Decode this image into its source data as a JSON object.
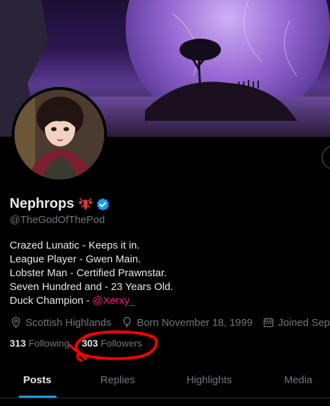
{
  "profile": {
    "name": "Nephrops",
    "name_emoji": "🦞",
    "handle": "@TheGodOfThePod",
    "verified": true
  },
  "bio": {
    "line1": "Crazed Lunatic - Keeps it in.",
    "line2": "League Player - Gwen Main.",
    "line3": "Lobster Man - Certified Prawnstar.",
    "line4": "Seven Hundred and - 23 Years Old.",
    "line5_prefix": "Duck Champion - ",
    "line5_mention": "@Xerxy_"
  },
  "meta": {
    "location": "Scottish Highlands",
    "born": "Born November 18, 1999",
    "joined": "Joined Sep"
  },
  "stats": {
    "following_count": "313",
    "following_label": "Following",
    "followers_count": "303",
    "followers_label": "Followers"
  },
  "tabs": [
    {
      "label": "Posts",
      "active": true
    },
    {
      "label": "Replies",
      "active": false
    },
    {
      "label": "Highlights",
      "active": false
    },
    {
      "label": "Media",
      "active": false
    }
  ],
  "colors": {
    "background": "#000000",
    "text": "#e7e9ea",
    "muted": "#71767b",
    "accent": "#1d9bf0",
    "mention": "#f91880",
    "annotation": "#ff0000"
  },
  "icons": {
    "location": "location-pin-icon",
    "born": "balloon-icon",
    "joined": "calendar-icon",
    "verified": "verified-badge-icon"
  }
}
